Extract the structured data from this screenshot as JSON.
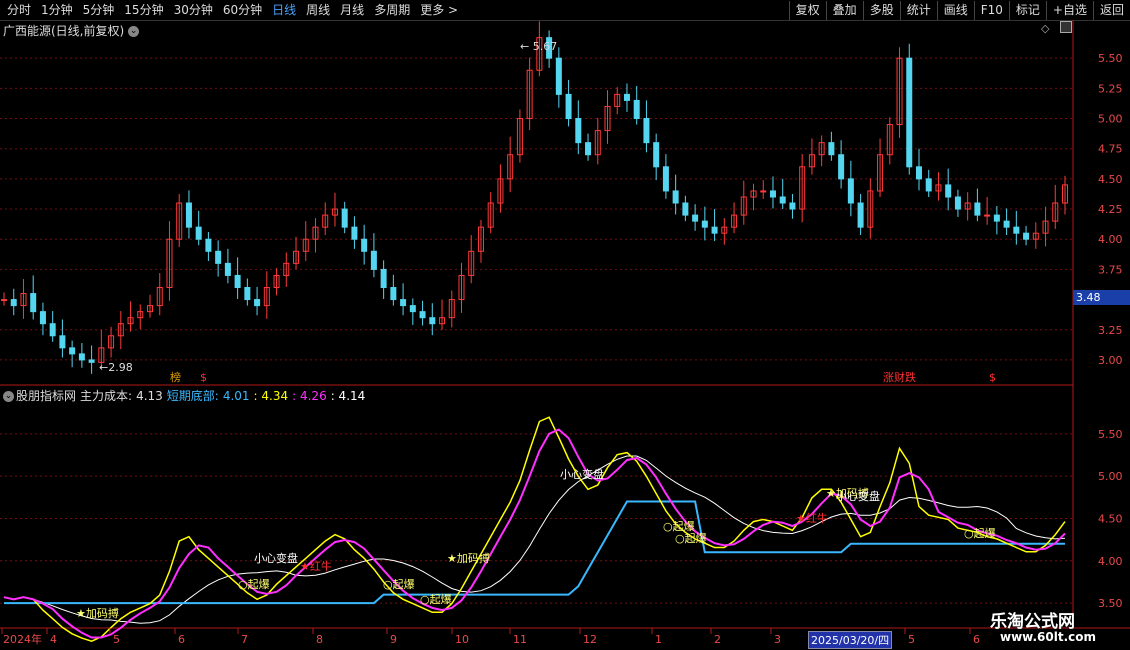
{
  "tabs": [
    "分时",
    "1分钟",
    "5分钟",
    "15分钟",
    "30分钟",
    "60分钟",
    "日线",
    "周线",
    "月线",
    "多周期",
    "更多 >"
  ],
  "active_tab_index": 6,
  "toolbar": [
    "复权",
    "叠加",
    "多股",
    "统计",
    "画线",
    "F10",
    "标记",
    "+自选",
    "返回"
  ],
  "stock_title": "广西能源(日线,前复权)",
  "upper_y_labels": [
    "5.50",
    "5.25",
    "5.00",
    "4.75",
    "4.50",
    "4.25",
    "4.00",
    "3.75",
    "3.48",
    "3.25",
    "3.00"
  ],
  "current_price": "3.48",
  "high_label": "5.67",
  "low_label": "2.98",
  "upper_marks": [
    {
      "text": "榜",
      "color": "#e0a000"
    },
    {
      "text": "$",
      "color": "#ff3030"
    },
    {
      "text": "涨财跌",
      "color": "#ff3030"
    },
    {
      "text": "$",
      "color": "#ff3030"
    }
  ],
  "indicator": {
    "name": "股朋指标网",
    "main_cost_label": "主力成本:",
    "main_cost": "4.13",
    "short_bottom_label": "短期底部:",
    "short_bottom": "4.01",
    "v3": ": 4.34",
    "v4": ": 4.26",
    "v5": ": 4.14"
  },
  "lower_y_labels": [
    "5.50",
    "5.00",
    "4.50",
    "4.00",
    "3.50"
  ],
  "signals": {
    "qibao": "起爆",
    "jiama": "加码搏",
    "hongniu": "红牛",
    "xiaopan": "小心变盘"
  },
  "x_labels": [
    "2024年",
    "4",
    "5",
    "6",
    "7",
    "8",
    "9",
    "10",
    "11",
    "12",
    "1",
    "2",
    "3",
    "5",
    "6"
  ],
  "date_tag": "2025/03/20/四",
  "watermark1": "乐淘公式网",
  "watermark2": "www.60lt.com",
  "chart_data": {
    "type": "candlestick",
    "stock": "广西能源",
    "x_range": [
      "2024-03",
      "2025-06"
    ],
    "upper_ylim": [
      2.9,
      5.75
    ],
    "lower_ylim": [
      3.3,
      5.9
    ],
    "close_series": [
      3.5,
      3.45,
      3.55,
      3.4,
      3.3,
      3.2,
      3.1,
      3.05,
      3.0,
      2.98,
      3.1,
      3.2,
      3.3,
      3.35,
      3.4,
      3.45,
      3.6,
      4.0,
      4.3,
      4.1,
      4.0,
      3.9,
      3.8,
      3.7,
      3.6,
      3.5,
      3.45,
      3.6,
      3.7,
      3.8,
      3.9,
      4.0,
      4.1,
      4.2,
      4.25,
      4.1,
      4.0,
      3.9,
      3.75,
      3.6,
      3.5,
      3.45,
      3.4,
      3.35,
      3.3,
      3.35,
      3.5,
      3.7,
      3.9,
      4.1,
      4.3,
      4.5,
      4.7,
      5.0,
      5.4,
      5.67,
      5.5,
      5.2,
      5.0,
      4.8,
      4.7,
      4.9,
      5.1,
      5.2,
      5.15,
      5.0,
      4.8,
      4.6,
      4.4,
      4.3,
      4.2,
      4.15,
      4.1,
      4.05,
      4.1,
      4.2,
      4.35,
      4.4,
      4.4,
      4.35,
      4.3,
      4.25,
      4.6,
      4.7,
      4.8,
      4.7,
      4.5,
      4.3,
      4.1,
      4.4,
      4.7,
      4.95,
      5.5,
      4.6,
      4.5,
      4.4,
      4.45,
      4.35,
      4.25,
      4.3,
      4.2,
      4.2,
      4.15,
      4.1,
      4.05,
      4.0,
      4.05,
      4.15,
      4.3,
      4.45
    ],
    "series": [
      {
        "name": "主力成本",
        "color": "#ffffff"
      },
      {
        "name": "短期底部",
        "color": "#3ab8ff"
      },
      {
        "name": "yellow",
        "color": "#ffff00"
      },
      {
        "name": "magenta",
        "color": "#ff2fff"
      }
    ]
  }
}
